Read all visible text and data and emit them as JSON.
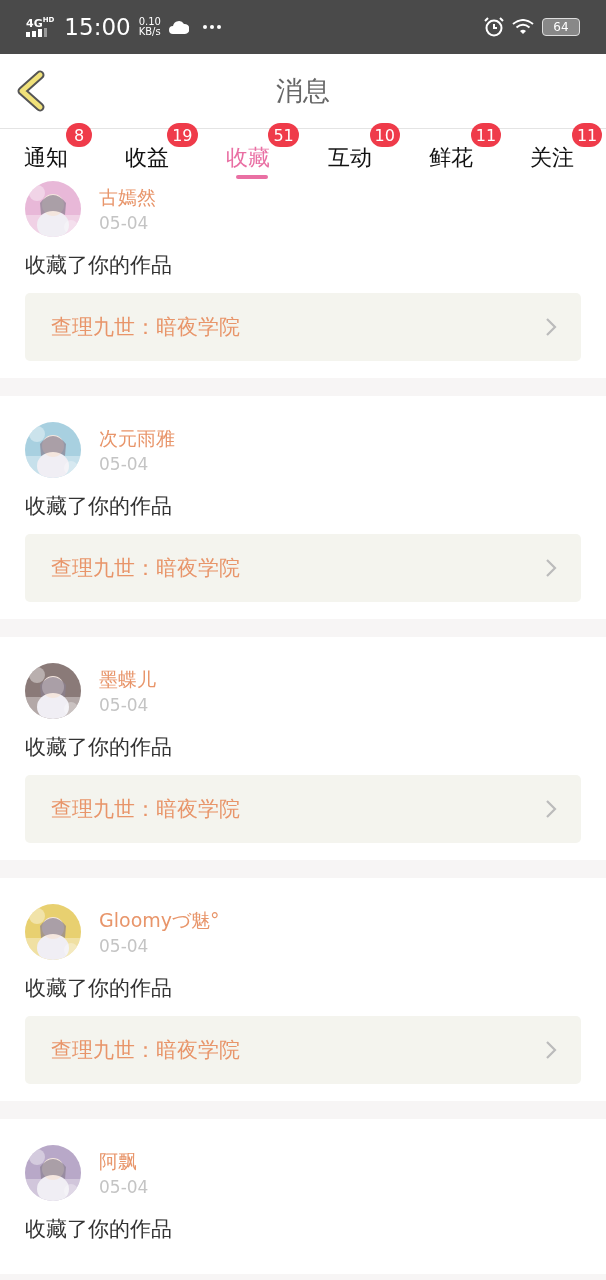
{
  "status_bar": {
    "network": "4G",
    "network_sup": "HD",
    "time": "15:00",
    "speed": "0.10",
    "speed_unit": "KB/s",
    "battery": "64"
  },
  "header": {
    "title": "消息"
  },
  "tabs": [
    {
      "label": "通知",
      "badge": "8",
      "selected": false
    },
    {
      "label": "收益",
      "badge": "19",
      "selected": false
    },
    {
      "label": "收藏",
      "badge": "51",
      "selected": true
    },
    {
      "label": "互动",
      "badge": "10",
      "selected": false
    },
    {
      "label": "鲜花",
      "badge": "11",
      "selected": false
    },
    {
      "label": "关注",
      "badge": "11",
      "selected": false
    }
  ],
  "messages": [
    {
      "name": "古嫣然",
      "date": "05-04",
      "text": "收藏了你的作品",
      "work": "查理九世：暗夜学院"
    },
    {
      "name": "次元雨雅",
      "date": "05-04",
      "text": "收藏了你的作品",
      "work": "查理九世：暗夜学院"
    },
    {
      "name": "墨蝶儿",
      "date": "05-04",
      "text": "收藏了你的作品",
      "work": "查理九世：暗夜学院"
    },
    {
      "name": "Gloomyづ魅°",
      "date": "05-04",
      "text": "收藏了你的作品",
      "work": "查理九世：暗夜学院"
    },
    {
      "name": "阿飘",
      "date": "05-04",
      "text": "收藏了你的作品"
    }
  ]
}
